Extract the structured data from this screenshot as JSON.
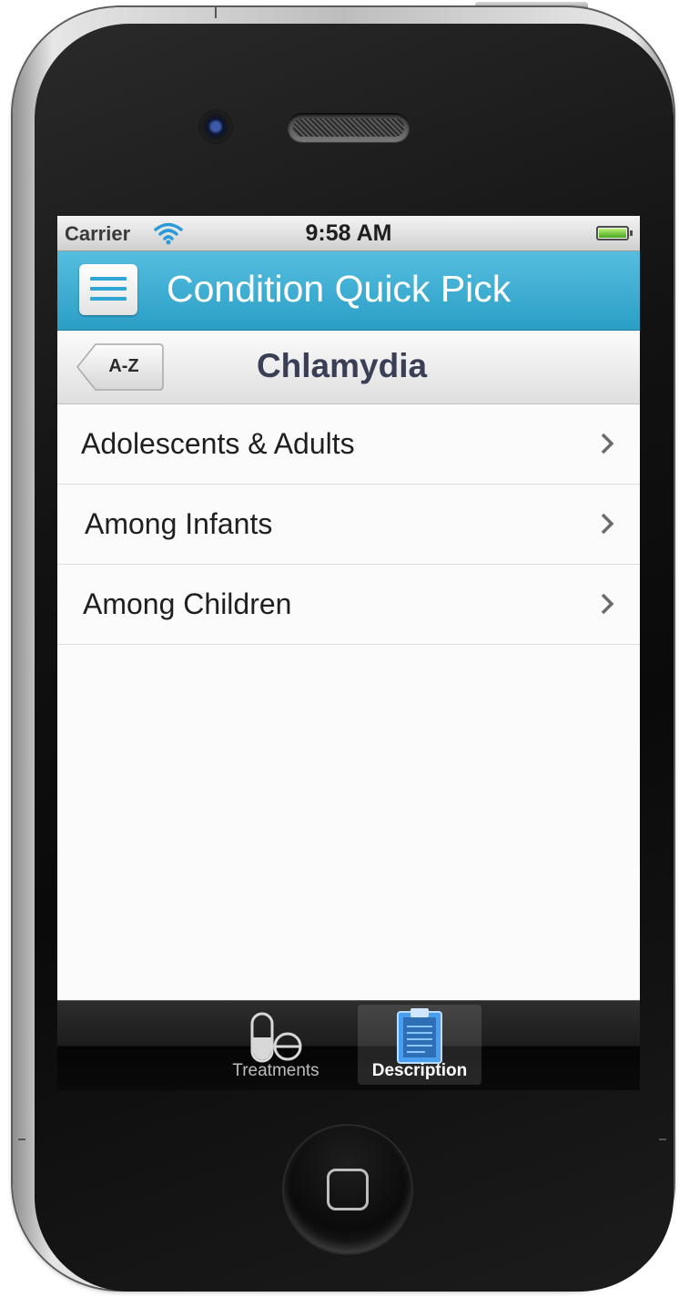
{
  "status_bar": {
    "carrier": "Carrier",
    "time": "9:58 AM"
  },
  "header": {
    "title": "Condition Quick Pick"
  },
  "subheader": {
    "back_label": "A-Z",
    "title": "Chlamydia"
  },
  "list": {
    "items": [
      {
        "label": "Adolescents & Adults"
      },
      {
        "label": "Among Infants"
      },
      {
        "label": "Among Children"
      }
    ]
  },
  "tabs": [
    {
      "label": "Treatments",
      "icon": "pills-icon",
      "active": false
    },
    {
      "label": "Description",
      "icon": "clipboard-icon",
      "active": true
    }
  ],
  "colors": {
    "header": "#2b9ec6",
    "accent": "#2da6d4",
    "active_tab_icon": "#3d8fe0"
  }
}
